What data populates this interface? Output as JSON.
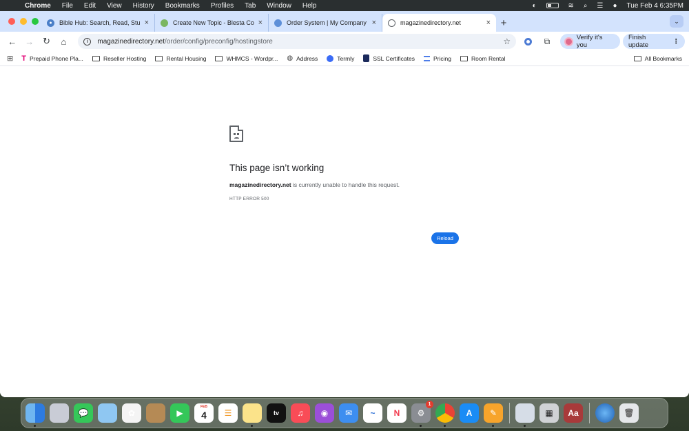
{
  "menubar": {
    "app_name": "Chrome",
    "items": [
      "File",
      "Edit",
      "View",
      "History",
      "Bookmarks",
      "Profiles",
      "Tab",
      "Window",
      "Help"
    ],
    "datetime": "Tue Feb 4  6:35PM"
  },
  "tabs": [
    {
      "title": "Bible Hub: Search, Read, Stu",
      "active": false
    },
    {
      "title": "Create New Topic - Blesta Co",
      "active": false
    },
    {
      "title": "Order System | My Company",
      "active": false
    },
    {
      "title": "magazinedirectory.net",
      "active": true
    }
  ],
  "toolbar": {
    "url_host": "magazinedirectory.net",
    "url_path": "/order/config/preconfig/hostingstore",
    "verify_label": "Verify it's you",
    "finish_update_label": "Finish update"
  },
  "bookmarks": {
    "items": [
      {
        "label": "Prepaid Phone Pla...",
        "icon": "tmobile-icon"
      },
      {
        "label": "Reseller Hosting",
        "icon": "folder-icon"
      },
      {
        "label": "Rental Housing",
        "icon": "folder-icon"
      },
      {
        "label": "WHMCS - Wordpr...",
        "icon": "folder-icon"
      },
      {
        "label": "Address",
        "icon": "globe-icon"
      },
      {
        "label": "Termly",
        "icon": "termly-icon"
      },
      {
        "label": "SSL Certificates",
        "icon": "ssl-icon"
      },
      {
        "label": "Pricing",
        "icon": "pricing-icon"
      },
      {
        "label": "Room Rental",
        "icon": "folder-icon"
      }
    ],
    "all_label": "All Bookmarks"
  },
  "error_page": {
    "title": "This page isn’t working",
    "host": "magazinedirectory.net",
    "desc_suffix": " is currently unable to handle this request.",
    "code": "HTTP ERROR 500",
    "reload_label": "Reload"
  },
  "dock": {
    "calendar_month": "FEB",
    "calendar_day": "4",
    "badge_count": "1",
    "tv_label": "tv"
  }
}
